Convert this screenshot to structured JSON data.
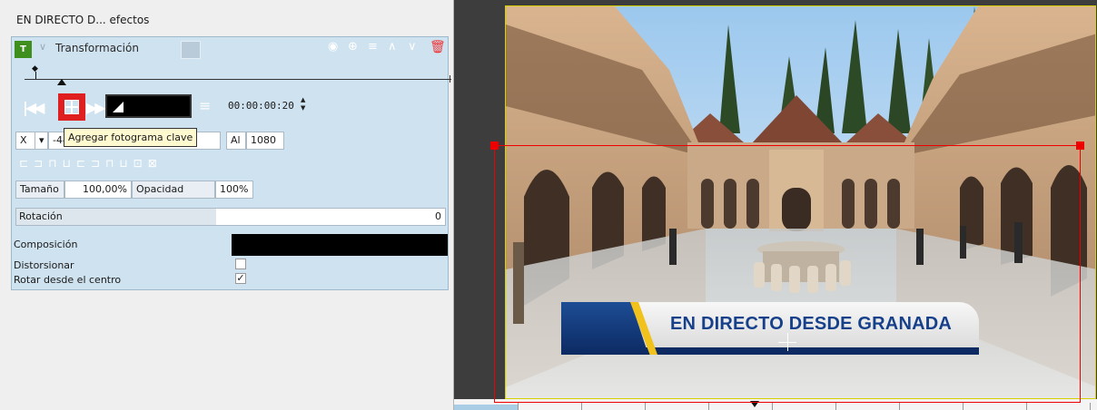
{
  "panel": {
    "title": "EN DIRECTO D... efectos"
  },
  "effect": {
    "badge": "T",
    "name": "Transformación",
    "timecode": "00:00:00:20",
    "tooltip": "Agregar fotograma clave",
    "x_label": "X",
    "x_value": "-44",
    "height_label": "Al",
    "height_value": "1080",
    "size_label": "Tamaño",
    "size_value": "100,00%",
    "opacity_label": "Opacidad",
    "opacity_value": "100%",
    "rotation_label": "Rotación",
    "rotation_value": "0",
    "composition_label": "Composición",
    "distort_label": "Distorsionar",
    "distort_checked": false,
    "rotate_center_label": "Rotar desde el centro",
    "rotate_center_checked": true,
    "rotate_center_mark": "✓"
  },
  "monitor": {
    "lower_third_text": "EN DIRECTO DESDE GRANADA"
  },
  "icons": {
    "eye": "eye-icon",
    "trash": "trash-icon",
    "prev_kf": "previous-keyframe-icon",
    "next_kf": "next-keyframe-icon",
    "add_kf": "add-keyframe-icon"
  },
  "colors": {
    "panel_bg": "#cfe2ef",
    "highlight": "#e02020",
    "frame_border": "#d6d000",
    "lower_third_blue": "#17408b",
    "lower_third_yellow": "#f1c21b"
  }
}
